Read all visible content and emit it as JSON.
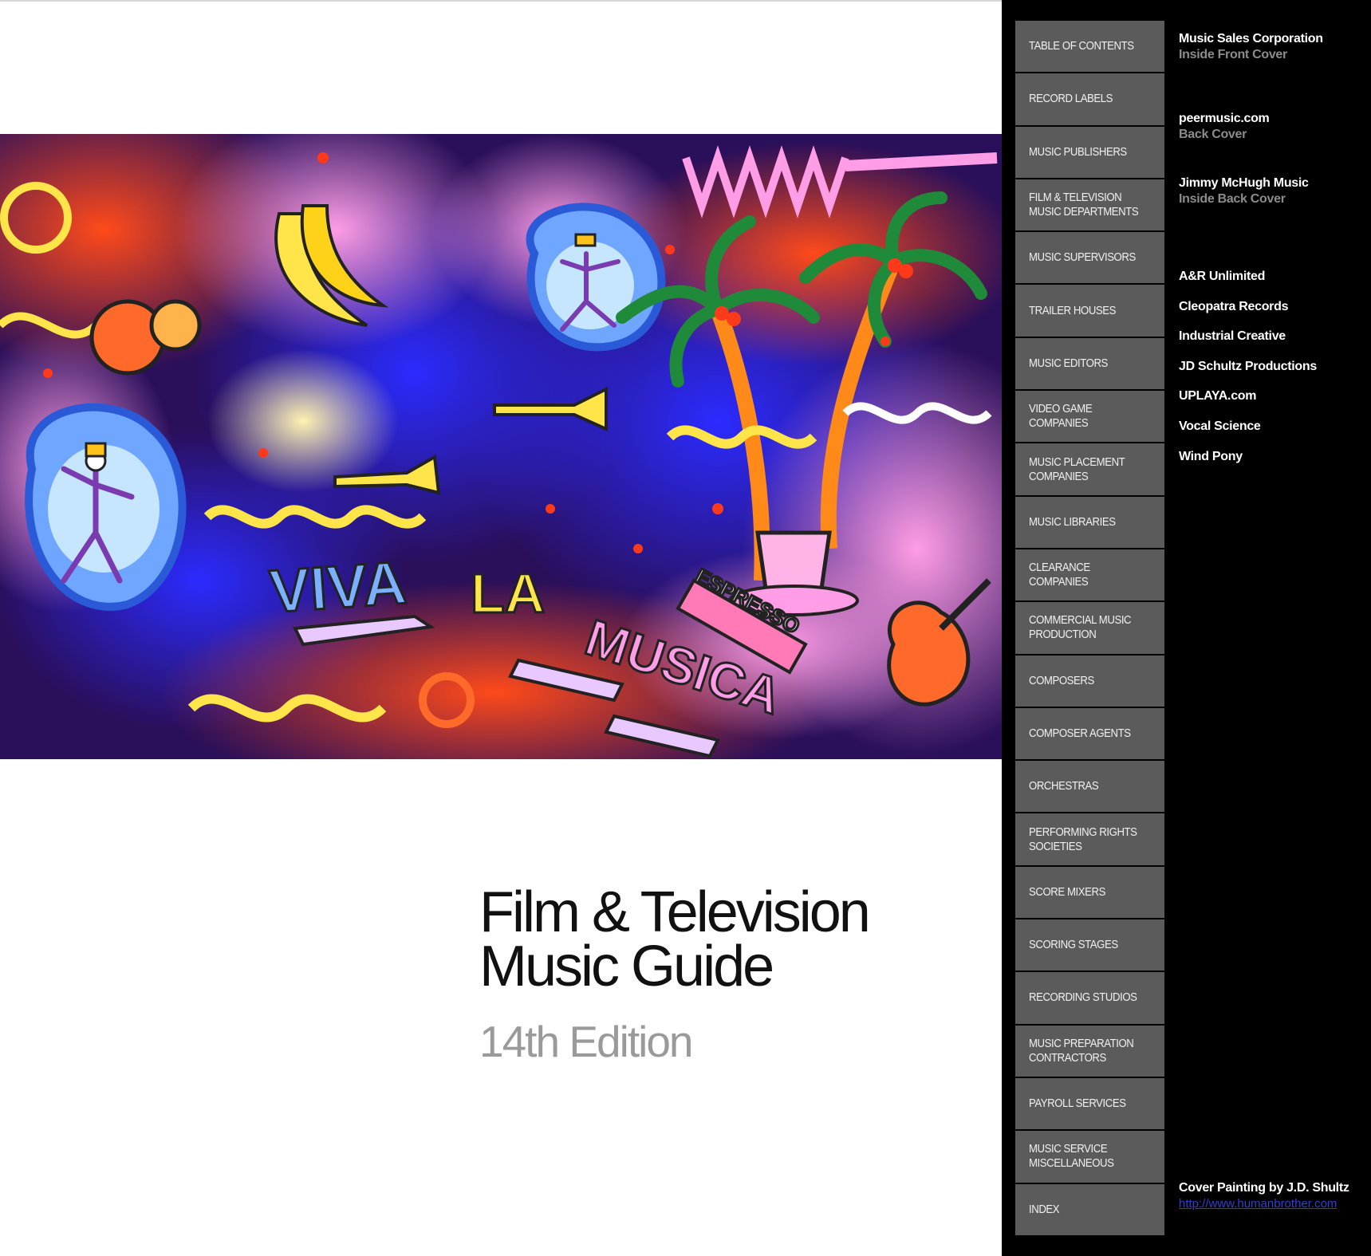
{
  "cover": {
    "title_line1": "Film & Television",
    "title_line2": "Music Guide",
    "edition": "14th Edition",
    "painting_lettering": [
      "VIVA",
      "LA",
      "MUSICA",
      "ESPRESSO"
    ]
  },
  "toc": [
    {
      "label": "TABLE OF CONTENTS"
    },
    {
      "label": "RECORD LABELS"
    },
    {
      "label": "MUSIC PUBLISHERS"
    },
    {
      "label": "FILM & TELEVISION\nMUSIC DEPARTMENTS"
    },
    {
      "label": "MUSIC SUPERVISORS"
    },
    {
      "label": "TRAILER HOUSES"
    },
    {
      "label": "MUSIC EDITORS"
    },
    {
      "label": "VIDEO GAME COMPANIES"
    },
    {
      "label": "MUSIC PLACEMENT\nCOMPANIES"
    },
    {
      "label": "MUSIC LIBRARIES"
    },
    {
      "label": "CLEARANCE COMPANIES"
    },
    {
      "label": "COMMERCIAL MUSIC\nPRODUCTION"
    },
    {
      "label": "COMPOSERS"
    },
    {
      "label": "COMPOSER AGENTS"
    },
    {
      "label": "ORCHESTRAS"
    },
    {
      "label": "PERFORMING RIGHTS\nSOCIETIES"
    },
    {
      "label": "SCORE MIXERS"
    },
    {
      "label": "SCORING STAGES"
    },
    {
      "label": "RECORDING STUDIOS"
    },
    {
      "label": "MUSIC PREPARATION\nCONTRACTORS"
    },
    {
      "label": "PAYROLL SERVICES"
    },
    {
      "label": "MUSIC SERVICE\nMISCELLANEOUS"
    },
    {
      "label": "INDEX"
    }
  ],
  "cover_ads": [
    {
      "name": "Music Sales Corporation",
      "placement": "Inside Front Cover"
    },
    {
      "name": "peermusic.com",
      "placement": "Back Cover"
    },
    {
      "name": "Jimmy McHugh Music",
      "placement": "Inside Back Cover"
    }
  ],
  "advertisers": [
    "A&R Unlimited",
    "Cleopatra Records",
    "Industrial Creative",
    "JD Schultz Productions",
    "UPLAYA.com",
    "Vocal Science",
    "Wind Pony"
  ],
  "credit": {
    "text": "Cover Painting by J.D. Shultz",
    "link": "http://www.humanbrother.com"
  },
  "colors": {
    "panel_bg": "#000000",
    "toc_button": "#5b5b5b",
    "link": "#2f3fd0",
    "edition_gray": "#9a9a9a"
  }
}
